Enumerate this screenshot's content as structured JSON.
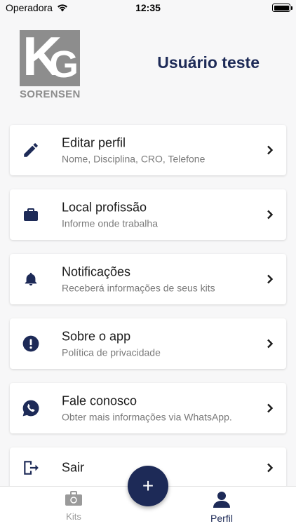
{
  "status_bar": {
    "carrier": "Operadora",
    "time": "12:35"
  },
  "header": {
    "logo_letters": "KG",
    "logo_text": "SORENSEN",
    "user_name": "Usuário teste"
  },
  "menu": [
    {
      "title": "Editar perfil",
      "subtitle": "Nome, Disciplina, CRO, Telefone",
      "icon": "pencil-icon"
    },
    {
      "title": "Local profissão",
      "subtitle": "Informe onde trabalha",
      "icon": "briefcase-icon"
    },
    {
      "title": "Notificações",
      "subtitle": "Receberá informações de seus kits",
      "icon": "bell-icon"
    },
    {
      "title": "Sobre o app",
      "subtitle": "Política de privacidade",
      "icon": "info-circle-icon"
    },
    {
      "title": "Fale conosco",
      "subtitle": "Obter mais informações via WhatsApp.",
      "icon": "whatsapp-icon"
    },
    {
      "title": "Sair",
      "subtitle": "",
      "icon": "logout-icon"
    }
  ],
  "tabs": [
    {
      "label": "Kits",
      "icon": "toolbox-icon",
      "active": false
    },
    {
      "label": "Perfil",
      "icon": "user-icon",
      "active": true
    }
  ],
  "fab": {
    "icon": "plus-icon",
    "label": "+"
  },
  "colors": {
    "primary": "#1d2a57",
    "logo_gray": "#8d8d8d",
    "inactive": "#9a9a9a"
  }
}
